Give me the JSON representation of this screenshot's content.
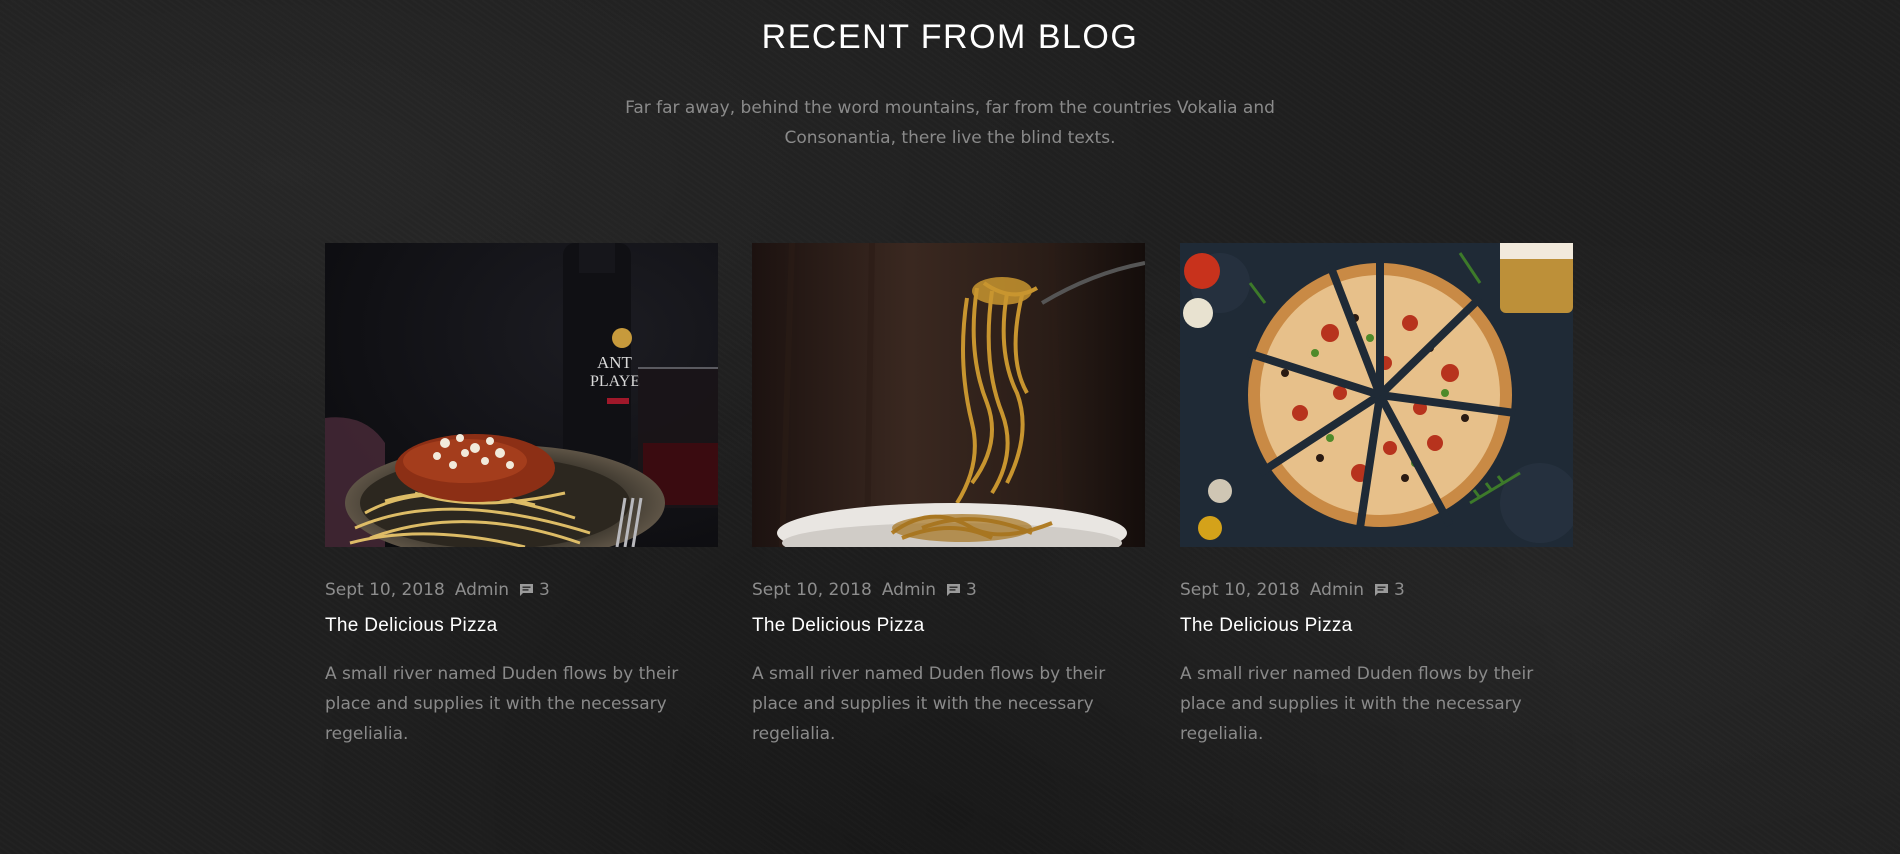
{
  "section": {
    "title": "RECENT FROM BLOG",
    "subtitle": "Far far away, behind the word mountains, far from the countries Vokalia and Consonantia, there live the blind texts."
  },
  "posts": [
    {
      "date": "Sept 10, 2018",
      "author": "Admin",
      "comments": "3",
      "title": "The Delicious Pizza",
      "excerpt": "A small river named Duden flows by their place and supplies it with the necessary regelialia.",
      "image_icon": "spaghetti-bolognese-photo"
    },
    {
      "date": "Sept 10, 2018",
      "author": "Admin",
      "comments": "3",
      "title": "The Delicious Pizza",
      "excerpt": "A small river named Duden flows by their place and supplies it with the necessary regelialia.",
      "image_icon": "pasta-on-fork-photo"
    },
    {
      "date": "Sept 10, 2018",
      "author": "Admin",
      "comments": "3",
      "title": "The Delicious Pizza",
      "excerpt": "A small river named Duden flows by their place and supplies it with the necessary regelialia.",
      "image_icon": "sliced-pizza-photo"
    }
  ],
  "colors": {
    "background": "#1f1f1f",
    "heading": "#ffffff",
    "muted_text": "#8a8a8a"
  }
}
